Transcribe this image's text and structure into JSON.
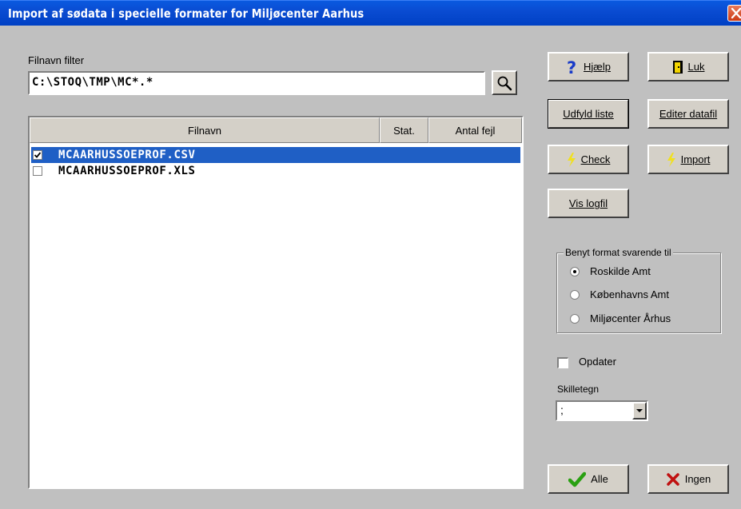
{
  "window": {
    "title": "Import af sødata i specielle formater for Miljøcenter Aarhus"
  },
  "filter": {
    "label": "Filnavn filter",
    "value": "C:\\STOQ\\TMP\\MC*.*"
  },
  "list": {
    "columns": [
      "Filnavn",
      "Stat.",
      "Antal fejl"
    ],
    "rows": [
      {
        "name": "MCAARHUSSOEPROF.CSV",
        "checked": true,
        "selected": true
      },
      {
        "name": "MCAARHUSSOEPROF.XLS",
        "checked": false,
        "selected": false
      }
    ]
  },
  "buttons": {
    "help": "Hjælp",
    "close": "Luk",
    "fill_list": "Udfyld liste",
    "edit_datafile": "Editer datafil",
    "check": "Check",
    "import": "Import",
    "show_log": "Vis logfil",
    "all": "Alle",
    "none": "Ingen"
  },
  "format_group": {
    "legend": "Benyt format svarende til",
    "options": [
      "Roskilde Amt",
      "Københavns Amt",
      "Miljøcenter Århus"
    ],
    "selected_index": 0
  },
  "update": {
    "label": "Opdater",
    "checked": false
  },
  "separator": {
    "label": "Skilletegn",
    "value": ";"
  },
  "icons": [
    "close-icon",
    "search-icon",
    "help-icon",
    "door-exit-icon",
    "lightning-icon",
    "checkmark-icon",
    "x-icon",
    "dropdown-arrow-icon"
  ]
}
